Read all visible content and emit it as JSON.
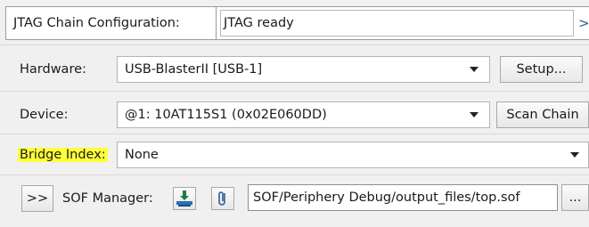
{
  "chain": {
    "label": "JTAG Chain Configuration:",
    "status": "JTAG ready",
    "collapse_glyph": ">"
  },
  "hardware": {
    "label": "Hardware:",
    "value": "USB-BlasterII [USB-1]",
    "setup_label": "Setup..."
  },
  "device": {
    "label": "Device:",
    "value": "@1: 10AT115S1 (0x02E060DD)",
    "scan_label": "Scan Chain"
  },
  "bridge": {
    "label": "Bridge Index:",
    "value": "None",
    "highlight_color": "#ffff3a"
  },
  "sof": {
    "expand_label": ">>",
    "label": "SOF Manager:",
    "path": "SOF/Periphery Debug/output_files/top.sof",
    "browse_label": "...",
    "icons": [
      "program-device-icon",
      "attach-file-icon"
    ]
  }
}
